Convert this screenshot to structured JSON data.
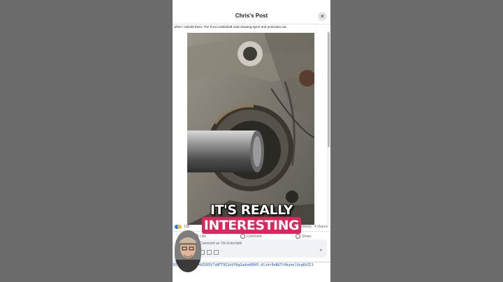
{
  "header": {
    "title": "Chris's Post",
    "close_glyph": "✕"
  },
  "post": {
    "text": "when I rebuild them. The front crankshaft main bearing spins and protrudes out."
  },
  "caption": {
    "plain": "IT'S REALLY",
    "highlight": "INTERESTING",
    "highlight_color": "#e0245e"
  },
  "stats": {
    "reaction_count": "138",
    "comments": "89 comments",
    "shares": "4 shares"
  },
  "actions": {
    "like": "Like",
    "comment": "Comment",
    "share": "Share"
  },
  "comment_box": {
    "placeholder": "Comment as Tim Esterdahl",
    "send_glyph": "➤"
  },
  "url": {
    "text": "93...ft__[0]=AZU95V7sNTT9I2eVY8g2wdsmDR45-dlzkr0nNG7lHkymslUxgKhZC1"
  },
  "icons": [
    "close-icon",
    "like-reaction-icon",
    "haha-reaction-icon",
    "like-icon",
    "comment-icon",
    "share-icon",
    "camera-icon",
    "gif-icon",
    "sticker-icon",
    "send-icon"
  ],
  "colors": {
    "accent": "#1877f2",
    "caption_highlight": "#e0245e"
  }
}
